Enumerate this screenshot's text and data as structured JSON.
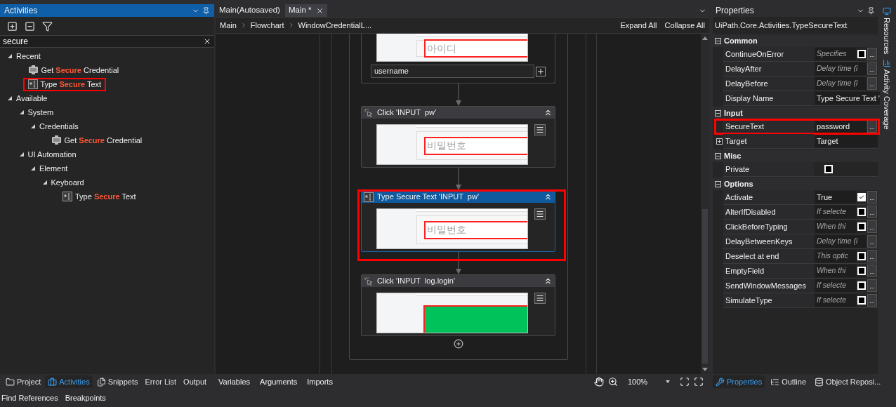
{
  "activities_panel": {
    "title": "Activities",
    "search": {
      "value": "secure"
    },
    "tree": [
      {
        "label": "Recent",
        "expanded": true,
        "children": [
          {
            "label": "Get **Secure** Credential",
            "kind": "credential",
            "highlighted": false
          },
          {
            "label": "Type **Secure** Text",
            "kind": "secure_text",
            "highlighted": true
          }
        ]
      },
      {
        "label": "Available",
        "expanded": true,
        "children": [
          {
            "label": "System",
            "expanded": true,
            "children": [
              {
                "label": "Credentials",
                "expanded": true,
                "children": [
                  {
                    "label": "Get **Secure** Credential",
                    "kind": "credential",
                    "highlighted": false
                  }
                ]
              }
            ]
          },
          {
            "label": "UI Automation",
            "expanded": true,
            "children": [
              {
                "label": "Element",
                "expanded": true,
                "children": [
                  {
                    "label": "Keyboard",
                    "expanded": true,
                    "children": [
                      {
                        "label": "Type **Secure** Text",
                        "kind": "secure_text",
                        "highlighted": false
                      }
                    ]
                  }
                ]
              }
            ]
          }
        ]
      }
    ],
    "tabs": [
      {
        "label": "Project",
        "kind": "folder",
        "selected": false
      },
      {
        "label": "Activities",
        "kind": "activities",
        "selected": true
      },
      {
        "label": "Snippets",
        "kind": "snippets",
        "selected": false
      },
      {
        "label": "Error List",
        "kind": "plain",
        "selected": false
      },
      {
        "label": "Output",
        "kind": "plain",
        "selected": false
      }
    ]
  },
  "designer": {
    "tabs": [
      {
        "label": "Main(Autosaved)",
        "selected": false
      },
      {
        "label": "Main *",
        "selected": true
      }
    ],
    "breadcrumb": [
      "Main",
      "Flowchart",
      "WindowCredentialL..."
    ],
    "actions": [
      "Expand All",
      "Collapse All"
    ],
    "top_activity": {
      "target": {
        "kind": "input",
        "text": "아이디"
      },
      "field": {
        "value": "username"
      }
    },
    "steps": [
      {
        "kind": "click",
        "title": "Click 'INPUT  pw'",
        "selected": false,
        "highlighted": false,
        "target": {
          "kind": "input",
          "text": "비밀번호"
        }
      },
      {
        "kind": "secure_text",
        "title": "Type Secure Text 'INPUT  pw'",
        "selected": true,
        "highlighted": true,
        "target": {
          "kind": "input",
          "text": "비밀번호"
        }
      },
      {
        "kind": "click",
        "title": "Click 'INPUT  log.login'",
        "selected": false,
        "highlighted": false,
        "target": {
          "kind": "button"
        }
      }
    ],
    "bottom_tabs": [
      "Variables",
      "Arguments",
      "Imports"
    ],
    "zoom": "100%"
  },
  "properties": {
    "title": "Properties",
    "type_name": "UiPath.Core.Activities.TypeSecureText",
    "categories": [
      {
        "name": "Common",
        "expanded": true,
        "rows": [
          {
            "name": "ContinueOnError",
            "placeholder": "Specifies",
            "checked": false,
            "button": "...",
            "highlighted": false
          },
          {
            "name": "DelayAfter",
            "placeholder": "Delay time (i",
            "button": "...",
            "highlighted": false
          },
          {
            "name": "DelayBefore",
            "placeholder": "Delay time (i",
            "button": "...",
            "highlighted": false
          },
          {
            "name": "Display Name",
            "value": "Type Secure Text '",
            "highlighted": false
          }
        ]
      },
      {
        "name": "Input",
        "expanded": true,
        "rows": [
          {
            "name": "SecureText",
            "value": "password",
            "button": "...",
            "highlighted": true
          },
          {
            "name": "Target",
            "value": "Target",
            "expanded": false,
            "highlighted": false
          }
        ]
      },
      {
        "name": "Misc",
        "expanded": true,
        "rows": [
          {
            "name": "Private",
            "checked": false,
            "highlighted": false
          }
        ]
      },
      {
        "name": "Options",
        "expanded": true,
        "rows": [
          {
            "name": "Activate",
            "value": "True",
            "checked": true,
            "button": "...",
            "highlighted": false
          },
          {
            "name": "AlterIfDisabled",
            "placeholder": "If selecte",
            "checked": false,
            "button": "...",
            "highlighted": false
          },
          {
            "name": "ClickBeforeTyping",
            "placeholder": "When thi",
            "checked": false,
            "button": "...",
            "highlighted": false
          },
          {
            "name": "DelayBetweenKeys",
            "placeholder": "Delay time (i",
            "button": "...",
            "highlighted": false
          },
          {
            "name": "Deselect at end",
            "placeholder": "This optic",
            "checked": false,
            "button": "...",
            "highlighted": false
          },
          {
            "name": "EmptyField",
            "placeholder": "When thi",
            "checked": false,
            "button": "...",
            "highlighted": false
          },
          {
            "name": "SendWindowMessages",
            "placeholder": "If selecte",
            "checked": false,
            "button": "...",
            "highlighted": false
          },
          {
            "name": "SimulateType",
            "placeholder": "If selecte",
            "checked": false,
            "button": "...",
            "highlighted": false
          }
        ]
      }
    ],
    "tabs": [
      {
        "label": "Properties",
        "kind": "properties",
        "selected": true
      },
      {
        "label": "Outline",
        "kind": "outline",
        "selected": false
      },
      {
        "label": "Object Reposi...",
        "kind": "repository",
        "selected": false
      }
    ]
  },
  "side_tabs": [
    {
      "label": "Resources",
      "kind": "resources"
    },
    {
      "label": "Activity Coverage",
      "kind": "coverage"
    }
  ],
  "footer_tabs": [
    "Find References",
    "Breakpoints"
  ]
}
